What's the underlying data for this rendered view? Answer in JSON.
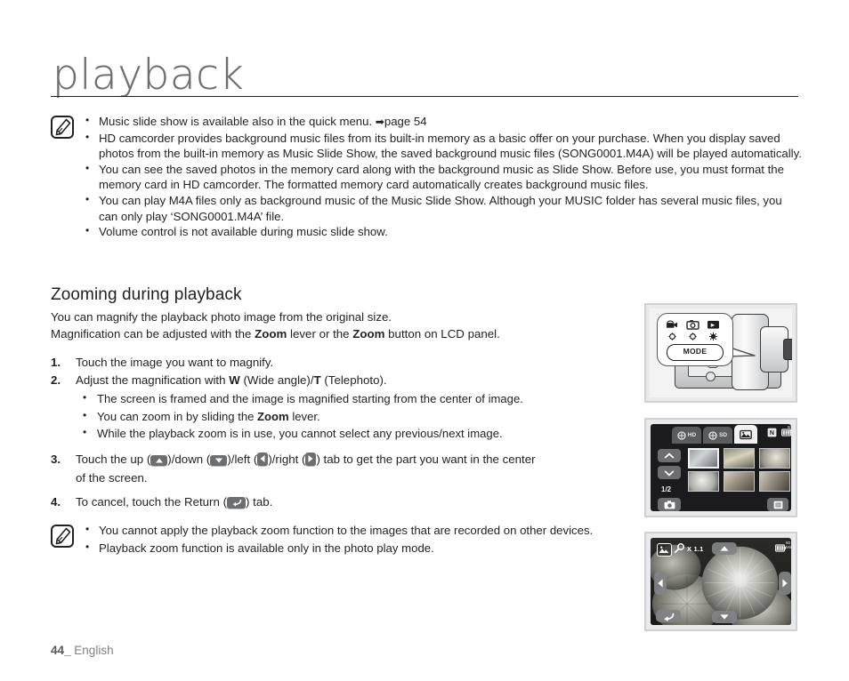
{
  "page": {
    "title": "playback",
    "footer_number": "44_",
    "footer_language": "English"
  },
  "note_top": {
    "icon": "note-pencil-icon",
    "items": [
      "Music slide show is available also in the quick menu. ➜ page 54",
      "HD camcorder provides background music files from its built-in memory as a basic offer on your purchase. When you display saved photos from the built-in memory as Music Slide Show, the saved background music files (SONG0001.M4A) will be played automatically.",
      "You can see the saved photos in the memory card along with the background music as Slide Show. Before use, you must format the memory card in HD camcorder. The formatted memory card automatically creates background music files.",
      "You can play M4A files only as background music of the Music Slide Show. Although your MUSIC folder has several music files, you can only play ‘SONG0001.M4A’ file.",
      "Volume control is not available during music slide show."
    ]
  },
  "section": {
    "heading": "Zooming during playback",
    "lead_line1": "You can magnify the playback photo image from the original size.",
    "lead_line2_a": "Magnification can be adjusted with the ",
    "lead_line2_zoom1": "Zoom",
    "lead_line2_b": " lever or the ",
    "lead_line2_zoom2": "Zoom",
    "lead_line2_c": " button on LCD panel."
  },
  "steps": {
    "step1": {
      "num": "1.",
      "text": "Touch the image you want to magnify."
    },
    "step2": {
      "num": "2.",
      "text_a": "Adjust the magnification with ",
      "bold_w": "W",
      "text_b": " (Wide angle)/",
      "bold_t": "T",
      "text_c": " (Telephoto).",
      "bullets": [
        "The screen is framed and the image is magnified starting from the center of image.",
        "You can zoom in by sliding the Zoom lever.",
        "While the playback zoom is in use, you cannot select any previous/next image."
      ],
      "bullet2_a": "You can zoom in by sliding the ",
      "bullet2_bold": "Zoom",
      "bullet2_b": " lever."
    },
    "step3": {
      "num": "3.",
      "text_a": "Touch the up (",
      "text_b": ")/down (",
      "text_c": ")/left (",
      "text_d": ")/right (",
      "text_e": ") tab to get the part you want in the center",
      "text_f": "of the screen.",
      "icon_up": "up-arrow-tab-icon",
      "icon_down": "down-arrow-tab-icon",
      "icon_left": "left-arrow-tab-icon",
      "icon_right": "right-arrow-tab-icon"
    },
    "step4": {
      "num": "4.",
      "text_a": "To cancel, touch the Return (",
      "text_b": ") tab.",
      "icon_return": "return-tab-icon"
    }
  },
  "note_bottom": {
    "icon": "note-pencil-icon",
    "items": [
      "You cannot apply the playback zoom function to the images that are recorded on other devices.",
      "Playback zoom function is available only in the photo play mode."
    ]
  },
  "figures": {
    "camcorder": {
      "name": "camcorder-mode-button-figure",
      "mode_button_label": "MODE",
      "mode_icons": [
        "video-mode-icon",
        "photo-mode-icon",
        "play-mode-icon"
      ]
    },
    "thumbnail_screen": {
      "name": "thumbnail-index-screen-figure",
      "tabs": [
        {
          "label": "HD",
          "icon": "hd-video-tab-icon",
          "active": false
        },
        {
          "label": "SD",
          "icon": "sd-video-tab-icon",
          "active": false
        },
        {
          "label": "",
          "icon": "photo-tab-icon",
          "active": true
        }
      ],
      "status_icons": [
        "memory-card-icon",
        "battery-icon"
      ],
      "battery_label": "60\nMin",
      "page_indicator": "1/2",
      "up_button": "scroll-up-button",
      "down_button": "scroll-down-button",
      "capture_button": "photo-capture-button",
      "menu_button": "menu-button",
      "thumbnails": 6
    },
    "zoom_screen": {
      "name": "playback-zoom-screen-figure",
      "photo_badge": "photo-play-mode-icon",
      "magnifier_icon": "magnifier-icon",
      "zoom_label": "X 1.1",
      "battery_icon": "battery-icon",
      "up_tab": "up-arrow-tab",
      "down_tab": "down-arrow-tab",
      "left_tab": "left-arrow-tab",
      "right_tab": "right-arrow-tab",
      "return_tab": "return-tab"
    }
  },
  "colors": {
    "text": "#231f20",
    "title": "#6e6e72",
    "footer": "#808285",
    "tab_gray": "#6d6e70",
    "frame": "#cfd1d2"
  }
}
